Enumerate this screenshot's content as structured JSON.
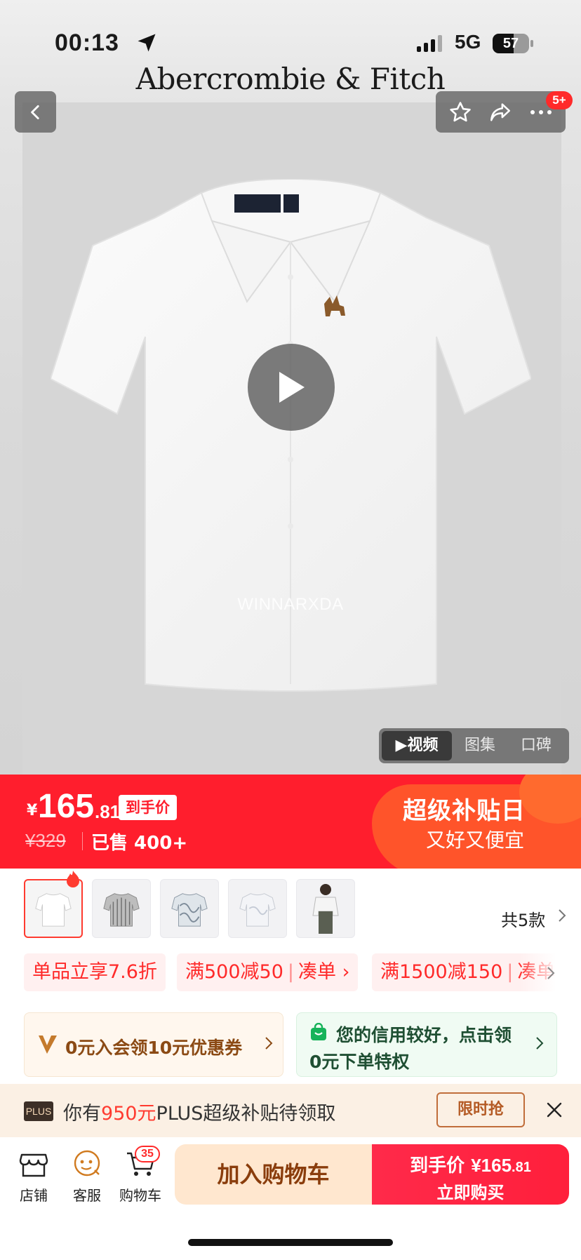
{
  "status_bar": {
    "time": "00:13",
    "network": "5G",
    "battery_level": "57",
    "battery_fraction": 0.57,
    "signal_bars": 3
  },
  "header": {
    "brand": "Abercrombie & Fitch",
    "message_badge": "5+"
  },
  "media": {
    "watermark": "WINNARXDA",
    "tabs": [
      {
        "label": "▶视频",
        "active": true
      },
      {
        "label": "图集",
        "active": false
      },
      {
        "label": "口碑",
        "active": false
      }
    ]
  },
  "price": {
    "currency": "¥",
    "integer": "165",
    "decimal": ".81",
    "final_tag": "到手价",
    "original": "¥329",
    "sold": "已售 400+",
    "promo_title": "超级补贴日",
    "promo_sub": "又好又便宜"
  },
  "variants": {
    "count_label": "共5款",
    "items": [
      {
        "name": "white-shirt",
        "selected": true
      },
      {
        "name": "grey-stripe-shirt",
        "selected": false
      },
      {
        "name": "blue-pattern-shirt",
        "selected": false
      },
      {
        "name": "light-pattern-shirt",
        "selected": false
      },
      {
        "name": "model-white-shirt",
        "selected": false
      }
    ]
  },
  "coupons": [
    {
      "text": "单品立享7.6折",
      "action": ""
    },
    {
      "text": "满500减50",
      "action": "凑单 ›"
    },
    {
      "text": "满1500减150",
      "action": "凑单"
    }
  ],
  "member_card": {
    "text": "0元入会领10元优惠券"
  },
  "credit_card": {
    "line1": "您的信用较好，点击领",
    "line2": "0元下单特权"
  },
  "plus_bar": {
    "logo": "PLUS",
    "prefix": "你有",
    "amount": "950元",
    "suffix": "PLUS超级补贴待领取",
    "button": "限时抢"
  },
  "bottom_nav": {
    "store": "店铺",
    "service": "客服",
    "cart": "购物车",
    "cart_badge": "35",
    "add_to_cart": "加入购物车",
    "buy_label": "到手价",
    "buy_price": "¥165",
    "buy_decimal": ".81",
    "buy_now": "立即购买"
  },
  "colors": {
    "brand_red": "#ff1e2d",
    "cart_button": "#ffe7cf",
    "member_brown": "#8b4a14",
    "credit_green": "#1f4f33"
  }
}
